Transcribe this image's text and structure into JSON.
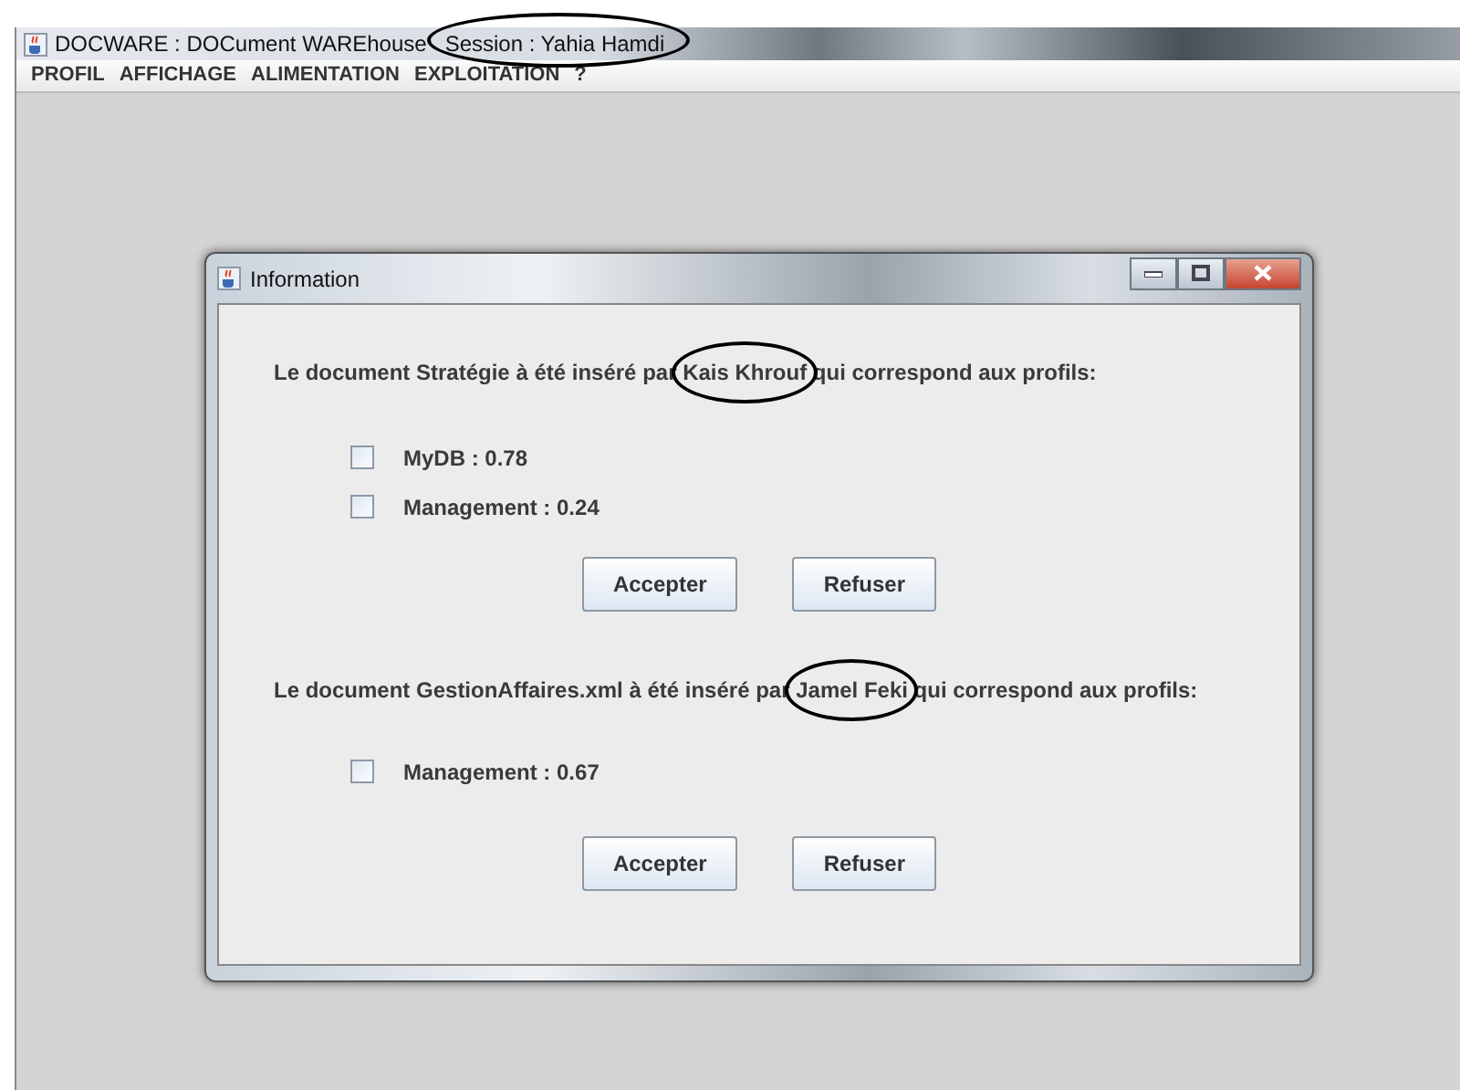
{
  "window": {
    "title": "DOCWARE : DOCument WAREhouse",
    "session": {
      "text": "Session : Yahia Hamdi",
      "circled": true
    }
  },
  "menu": [
    "PROFIL",
    "AFFICHAGE",
    "ALIMENTATION",
    "EXPLOITATION",
    "?"
  ],
  "dialog": {
    "title": "Information",
    "notices": [
      {
        "before": "Le document Stratégie à été inséré par ",
        "author": "Kais Khrouf",
        "after": " qui correspond aux profils:",
        "circled": true,
        "profiles": [
          {
            "label": "MyDB : 0.78",
            "checked": false
          },
          {
            "label": "Management : 0.24",
            "checked": false
          }
        ],
        "buttons": [
          "Accepter",
          "Refuser"
        ]
      },
      {
        "before": "Le document GestionAffaires.xml à été inséré par ",
        "author": "Jamel Feki",
        "after": " qui correspond aux profils:",
        "circled": true,
        "profiles": [
          {
            "label": "Management : 0.67",
            "checked": false
          }
        ],
        "buttons": [
          "Accepter",
          "Refuser"
        ]
      }
    ]
  }
}
